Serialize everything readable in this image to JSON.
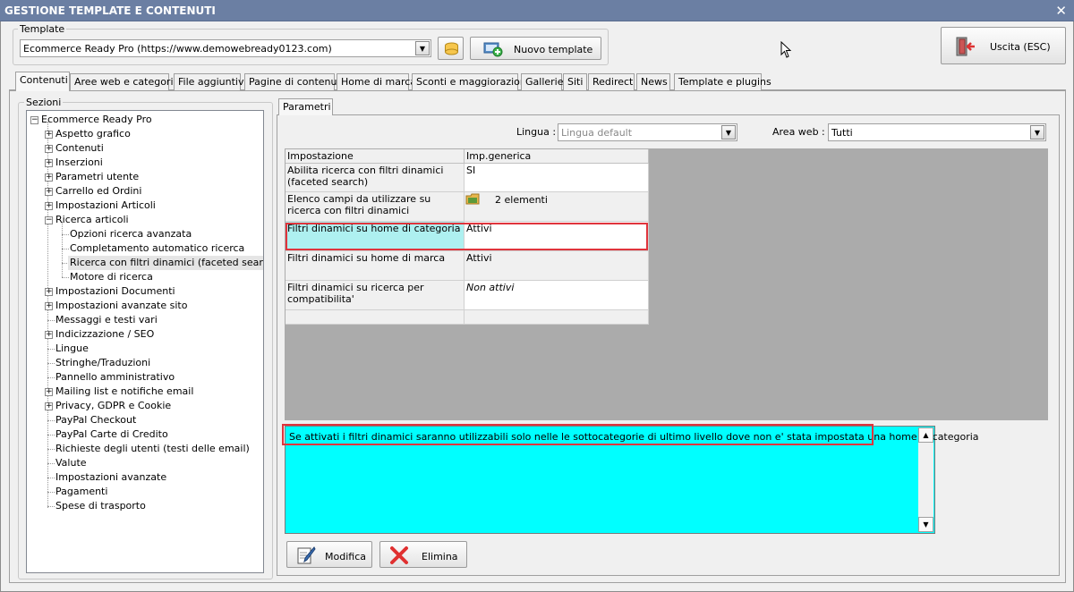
{
  "window": {
    "title": "GESTIONE TEMPLATE E CONTENUTI",
    "close_glyph": "✕"
  },
  "template": {
    "group_label": "Template",
    "selected": "Ecommerce Ready Pro (https://www.demowebready0123.com)",
    "new_button": "Nuovo template"
  },
  "exit_button": "Uscita (ESC)",
  "tabs": [
    "Contenuti",
    "Aree web e categorie",
    "File aggiuntivi",
    "Pagine di contenuti",
    "Home di marca",
    "Sconti e maggiorazioni",
    "Gallerie",
    "Siti",
    "Redirect",
    "News",
    "Template e plugins"
  ],
  "sections": {
    "label": "Sezioni",
    "root": "Ecommerce Ready Pro",
    "items": [
      "Aspetto grafico",
      "Contenuti",
      "Inserzioni",
      "Parametri utente",
      "Carrello ed Ordini",
      "Impostazioni Articoli",
      "Ricerca articoli"
    ],
    "sub_items": [
      "Opzioni ricerca avanzata",
      "Completamento automatico ricerca",
      "Ricerca con filtri dinamici (faceted search)",
      "Motore di ricerca"
    ],
    "items_after": [
      "Impostazioni Documenti",
      "Impostazioni avanzate sito",
      "Messaggi e testi vari",
      "Indicizzazione / SEO",
      "Lingue",
      "Stringhe/Traduzioni",
      "Pannello amministrativo",
      "Mailing list e notifiche email",
      "Privacy, GDPR e Cookie",
      "PayPal Checkout",
      "PayPal Carte di Credito",
      "Richieste degli utenti (testi delle email)",
      "Valute",
      "Impostazioni avanzate",
      "Pagamenti",
      "Spese di trasporto"
    ]
  },
  "params": {
    "tab": "Parametri",
    "lingua_label": "Lingua :",
    "lingua_value": "Lingua default",
    "area_label": "Area web :",
    "area_value": "Tutti",
    "col_setting": "Impostazione",
    "col_value": "Imp.generica",
    "rows": [
      {
        "setting": "Abilita ricerca con filtri dinamici (faceted search)",
        "value": "SI"
      },
      {
        "setting": "Elenco campi da utilizzare su ricerca con filtri dinamici",
        "value": "2 elementi"
      },
      {
        "setting": "Filtri dinamici su home di categoria",
        "value": "Attivi"
      },
      {
        "setting": "Filtri dinamici su home di marca",
        "value": "Attivi"
      },
      {
        "setting": "Filtri dinamici su ricerca per compatibilita'",
        "value": "Non attivi"
      }
    ],
    "description": "Se attivati i filtri dinamici saranno utilizzabili solo nelle le sottocategorie di ultimo livello dove non e' stata impostata una home di categoria",
    "edit_button": "Modifica",
    "delete_button": "Elimina"
  },
  "colors": {
    "titlebar": "#6b7fa3",
    "description_bg": "#00ffff",
    "highlight": "#e0343c",
    "selected_cell": "#aef0f0"
  }
}
